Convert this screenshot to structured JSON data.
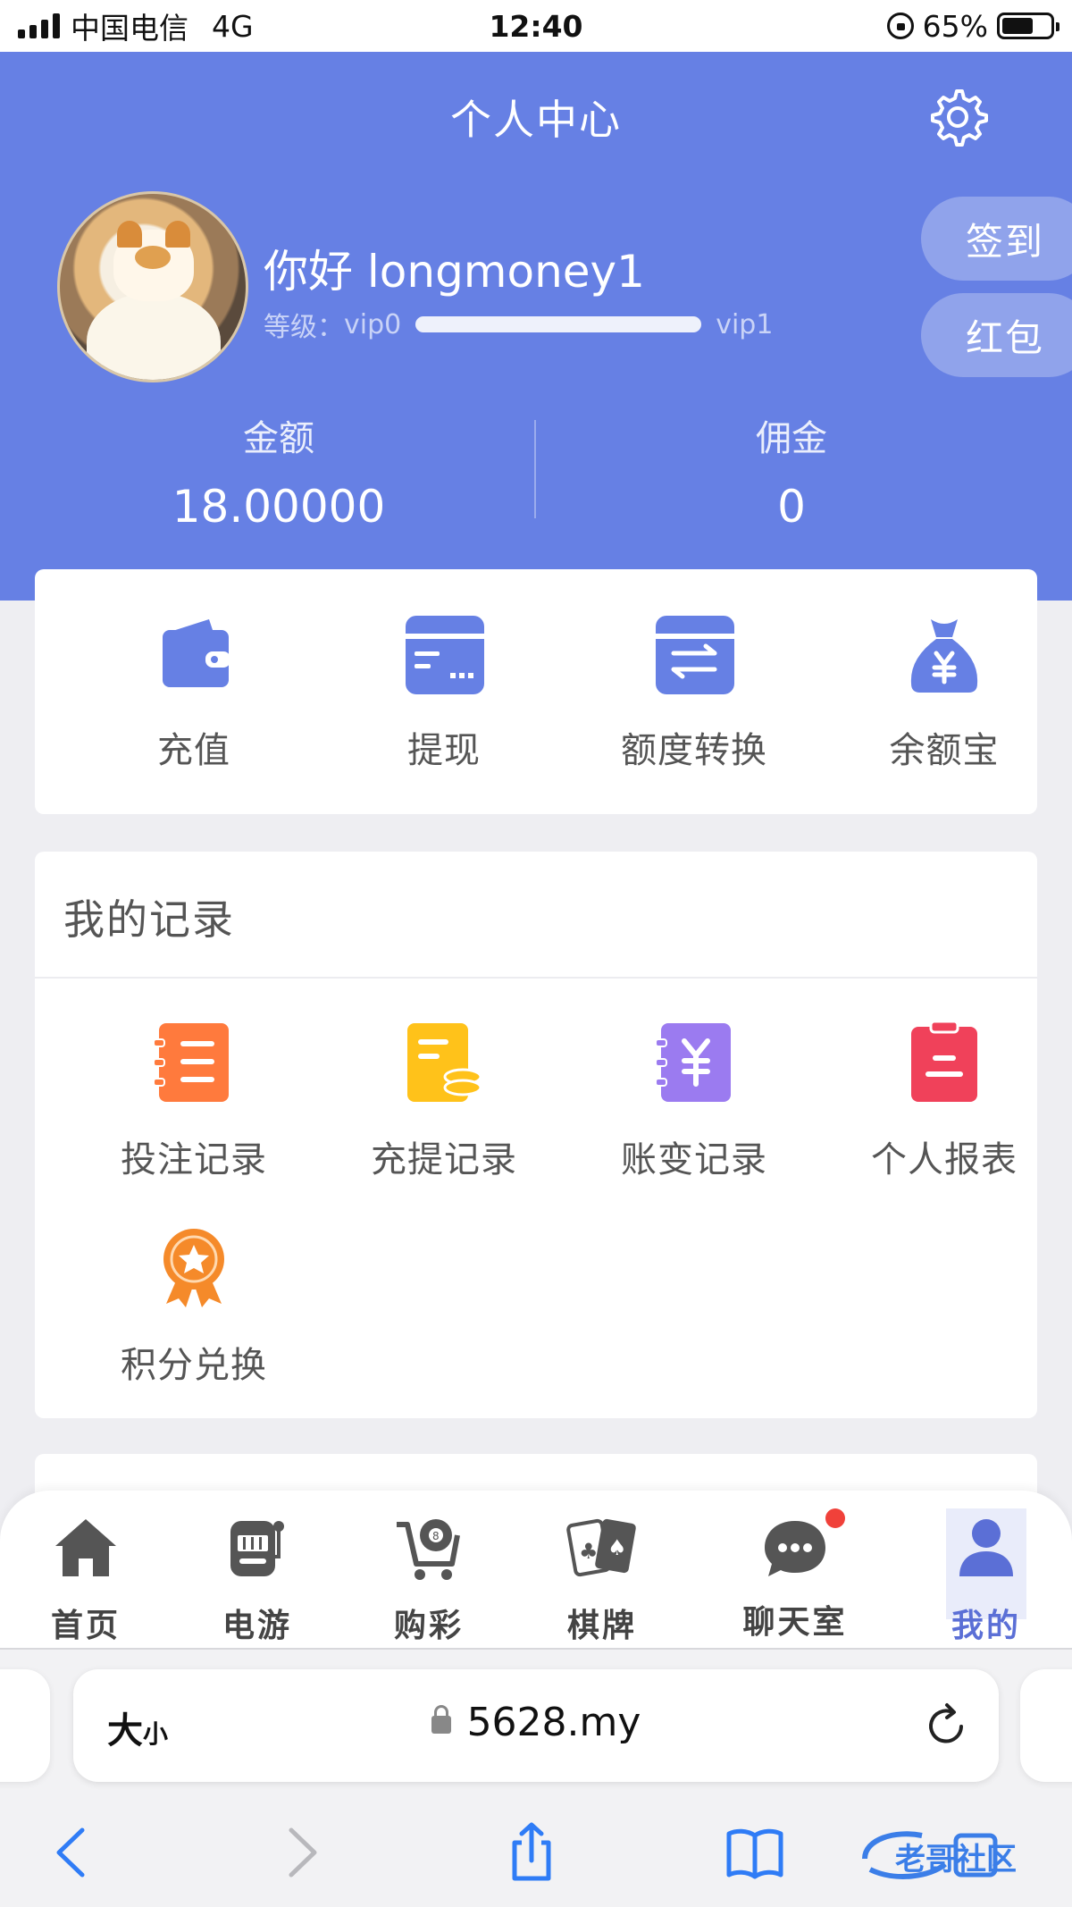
{
  "status_bar": {
    "carrier": "中国电信",
    "network": "4G",
    "time": "12:40",
    "battery": "65%",
    "battery_level": 0.65
  },
  "header": {
    "title": "个人中心",
    "greeting": "你好 longmoney1",
    "level_label": "等级：",
    "level_current": "vip0",
    "level_next": "vip1",
    "level_progress": 0,
    "sign_in_button": "签到",
    "red_packet_button": "红包",
    "balance_label": "金额",
    "balance_value": "18.00000",
    "commission_label": "佣金",
    "commission_value": "0"
  },
  "quick_actions": [
    {
      "label": "充值",
      "icon": "wallet-icon"
    },
    {
      "label": "提现",
      "icon": "card-icon"
    },
    {
      "label": "额度转换",
      "icon": "transfer-icon"
    },
    {
      "label": "余额宝",
      "icon": "money-bag-icon"
    }
  ],
  "records": {
    "title": "我的记录",
    "items": [
      {
        "label": "投注记录",
        "icon": "bet-record-icon"
      },
      {
        "label": "充提记录",
        "icon": "deposit-record-icon"
      },
      {
        "label": "账变记录",
        "icon": "account-change-icon"
      },
      {
        "label": "个人报表",
        "icon": "report-icon"
      },
      {
        "label": "积分兑换",
        "icon": "points-exchange-icon"
      }
    ]
  },
  "tabbar": [
    {
      "label": "首页",
      "icon": "home-icon"
    },
    {
      "label": "电游",
      "icon": "slot-machine-icon"
    },
    {
      "label": "购彩",
      "icon": "lottery-cart-icon"
    },
    {
      "label": "棋牌",
      "icon": "cards-icon"
    },
    {
      "label": "聊天室",
      "icon": "chat-icon"
    },
    {
      "label": "我的",
      "icon": "user-icon"
    }
  ],
  "browser": {
    "text_size": "大",
    "text_size_small": "小",
    "url": "5628.my"
  },
  "colors": {
    "header_blue": "#6680e4",
    "icon_blue": "#6680e4",
    "orange": "#ff7a3d",
    "yellow": "#ffc21a",
    "purple": "#9b7bf0",
    "red": "#f0415a",
    "active_tab": "#5b6fd6"
  }
}
